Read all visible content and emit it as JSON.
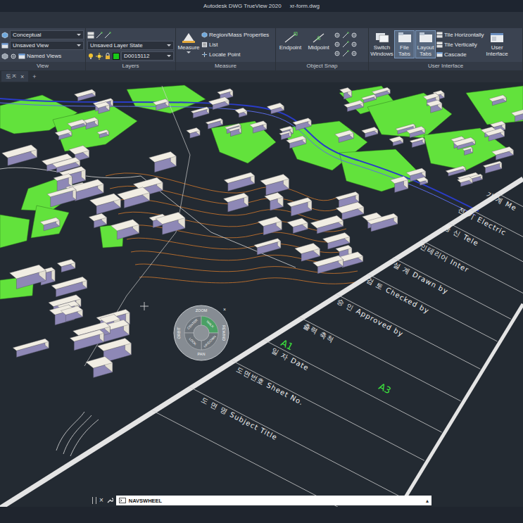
{
  "window": {
    "title": "Autodesk DWG TrueView 2020",
    "file": "xr-form.dwg"
  },
  "ribbon": {
    "view": {
      "visual_style": "Conceptual",
      "named_view": "Unsaved View",
      "named_views_button": "Named Views",
      "label": "View"
    },
    "layers": {
      "layer_state": "Unsaved Layer State",
      "current_layer": "D0015112",
      "layer_color": "#19c819",
      "label": "Layers"
    },
    "measure": {
      "button": "Measure",
      "items": [
        "Region/Mass Properties",
        "List",
        "Locate Point"
      ],
      "label": "Measure"
    },
    "object_snap": {
      "buttons": [
        "Endpoint",
        "Midpoint"
      ],
      "label": "Object Snap"
    },
    "user_interface": {
      "buttons": [
        {
          "label": "Switch Windows",
          "selected": false
        },
        {
          "label": "File Tabs",
          "selected": true
        },
        {
          "label": "Layout Tabs",
          "selected": true
        }
      ],
      "items": [
        "Tile Horizontally",
        "Tile Vertically",
        "Cascade"
      ],
      "user_interface_button": "User Interface",
      "label": "User Interface"
    }
  },
  "file_tabs": [
    {
      "label": "도ㅈ",
      "close": "×",
      "selected": true
    }
  ],
  "new_tab": "+",
  "drawing": {
    "title_block": [
      {
        "label": "기 계 Me"
      },
      {
        "label": "전 기 Electric"
      },
      {
        "label": "통 신 Tele"
      },
      {
        "label": "인테리어 Inter"
      },
      {
        "label": "설 계 Drawn by"
      },
      {
        "label": "검 토 Checked by"
      },
      {
        "label": "승 인 Approved by"
      },
      {
        "label": "출력 축척"
      },
      {
        "label": "일 자 Date"
      },
      {
        "label": "도면번호 Sheet No."
      },
      {
        "label": "도 면 명 Subject Title"
      }
    ],
    "sheet_sizes": [
      {
        "label": "A1"
      },
      {
        "label": "A3"
      }
    ]
  },
  "nav_wheel": {
    "close": "×",
    "outer": [
      {
        "label": "ZOOM"
      },
      {
        "label": "REWIND"
      },
      {
        "label": "PAN"
      },
      {
        "label": "ORBIT"
      }
    ],
    "inner": [
      {
        "label": "CENTER",
        "selected": false
      },
      {
        "label": "WALK",
        "selected": true
      },
      {
        "label": "UP/DOWN",
        "selected": false
      },
      {
        "label": "LOOK",
        "selected": false
      }
    ]
  },
  "command_line": {
    "close": "×",
    "value": "NAVSWHEEL",
    "expand": "▴"
  }
}
